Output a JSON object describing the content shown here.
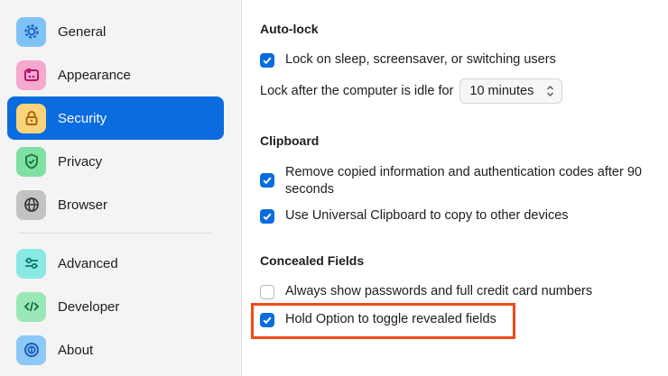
{
  "sidebar": {
    "items": [
      {
        "label": "General",
        "icon": "gear-icon",
        "icon_bg": "#7fc3f6",
        "icon_fg": "#1a66c8",
        "selected": false
      },
      {
        "label": "Appearance",
        "icon": "palette-icon",
        "icon_bg": "#f7a8cf",
        "icon_fg": "#b0186a",
        "selected": false
      },
      {
        "label": "Security",
        "icon": "lock-icon",
        "icon_bg": "#fbd37a",
        "icon_fg": "#a8680a",
        "selected": true
      },
      {
        "label": "Privacy",
        "icon": "shield-icon",
        "icon_bg": "#7fe0a3",
        "icon_fg": "#1b7c3e",
        "selected": false
      },
      {
        "label": "Browser",
        "icon": "globe-icon",
        "icon_bg": "#c3c3c6",
        "icon_fg": "#3a3a3c",
        "selected": false
      },
      {
        "label": "Advanced",
        "icon": "sliders-icon",
        "icon_bg": "#8ae9e3",
        "icon_fg": "#147a78",
        "selected": false
      },
      {
        "label": "Developer",
        "icon": "code-icon",
        "icon_bg": "#9ae8b8",
        "icon_fg": "#1b6b3e",
        "selected": false
      },
      {
        "label": "About",
        "icon": "info-icon",
        "icon_bg": "#8ec8f7",
        "icon_fg": "#1a5fb8",
        "selected": false
      }
    ]
  },
  "main": {
    "autolock": {
      "title": "Auto-lock",
      "lock_on_sleep": {
        "label": "Lock on sleep, screensaver, or switching users",
        "checked": true
      },
      "idle_label": "Lock after the computer is idle for",
      "idle_value": "10 minutes"
    },
    "clipboard": {
      "title": "Clipboard",
      "remove_copied": {
        "label_line1": "Remove copied information and authentication codes after 90",
        "label_line2": "seconds",
        "checked": true
      },
      "universal": {
        "label": "Use Universal Clipboard to copy to other devices",
        "checked": true
      }
    },
    "concealed": {
      "title": "Concealed Fields",
      "always_show": {
        "label": "Always show passwords and full credit card numbers",
        "checked": false
      },
      "hold_option": {
        "label": "Hold Option to toggle revealed fields",
        "checked": true
      }
    }
  },
  "colors": {
    "accent": "#0a6cdf",
    "highlight": "#f04a1c",
    "sidebar_bg": "#f4f4f4"
  }
}
